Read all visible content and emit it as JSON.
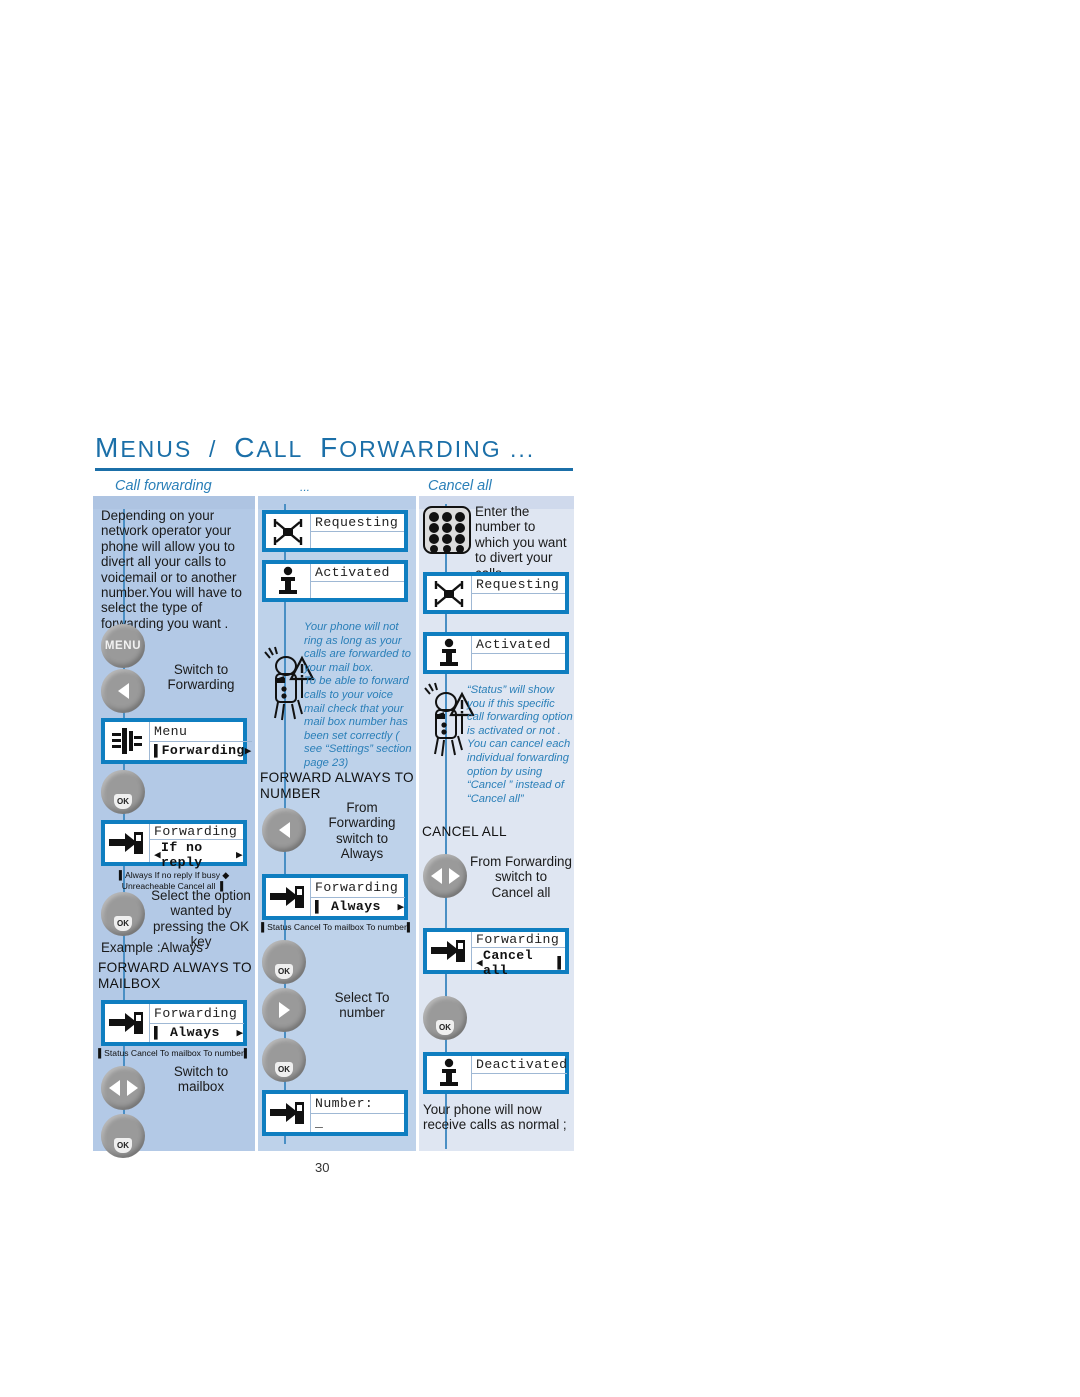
{
  "heading": {
    "text": "MENUS / CALL FORWARDING ...",
    "parts": [
      "M",
      "ENUS",
      " / ",
      "C",
      "ALL",
      " ",
      "F",
      "ORWARDING",
      " ..."
    ]
  },
  "columns": {
    "left": {
      "caption": "Call forwarding"
    },
    "middle": {
      "caption": "..."
    },
    "right": {
      "caption": "Cancel all"
    }
  },
  "left": {
    "intro": "Depending on your network operator your phone will allow you to divert all your calls to voicemail or to another number.You will have to select the type of forwarding you want .",
    "menu_key_label": "MENU",
    "step_switch_to_forwarding": "Switch to\nForwarding",
    "screen_menu": {
      "line1": "Menu",
      "line2": "Forwarding"
    },
    "screen_forwarding_ifnoreply": {
      "line1": "Forwarding",
      "line2": "If no reply"
    },
    "option_strip_1_a": "Always   If no reply       If busy",
    "option_strip_1_b": "Unreacheable   Cancel all",
    "step_select_option": "Select the option wanted by pressing the OK key",
    "example": "Example :Always",
    "section_title": "FORWARD ALWAYS TO MAILBOX",
    "screen_forwarding_always": {
      "line1": "Forwarding",
      "line2": "Always"
    },
    "option_strip_2": "Status   Cancel   To mailbox   To number",
    "step_switch_to_mailbox": "Switch to\nmailbox"
  },
  "middle": {
    "screen_requesting": {
      "line1": "Requesting",
      "line2": ""
    },
    "screen_activated": {
      "line1": "Activated",
      "line2": ""
    },
    "note": "Your phone will not ring as long as your calls are forwarded to your mail box.\nTo be able to forward calls to your voice mail check that your mail box number has been set correctly ( see “Settings” section page 23)",
    "section_title": "FORWARD ALWAYS TO NUMBER",
    "step_from_forwarding": "From\nForwarding\nswitch to\nAlways",
    "screen_forwarding_always": {
      "line1": "Forwarding",
      "line2": "Always"
    },
    "option_strip": "Status   Cancel   To mailbox   To number",
    "step_select_to_number": "Select To\nnumber",
    "screen_number": {
      "line1": "Number:",
      "line2": "_"
    }
  },
  "right": {
    "step_enter_number": "Enter the number to which you want to divert your calls",
    "screen_requesting": {
      "line1": "Requesting",
      "line2": ""
    },
    "screen_activated": {
      "line1": "Activated",
      "line2": ""
    },
    "note": "“Status” will show you if this specific call forwarding option is activated or not .\nYou can cancel each individual forwarding option by using “Cancel ” instead of “Cancel all”",
    "section_title": "CANCEL ALL",
    "step_from_forwarding_cancel": "From Forwarding\nswitch to\nCancel all",
    "screen_forwarding_cancelall": {
      "line1": "Forwarding",
      "line2": "Cancel all"
    },
    "screen_deactivated": {
      "line1": "Deactivated",
      "line2": ""
    },
    "outro": "Your phone will now receive calls as normal ;"
  },
  "footer": {
    "page_number": "30"
  },
  "colors": {
    "accent_blue": "#1b6fa8",
    "screen_border": "#0f7ec0",
    "col_left_bg": "#b3c9e6",
    "col_mid_bg": "#bed2ea",
    "col_right_bg": "#dfe6f2",
    "note_text": "#2a7fb8",
    "key_gray": "#9a9a9a"
  }
}
